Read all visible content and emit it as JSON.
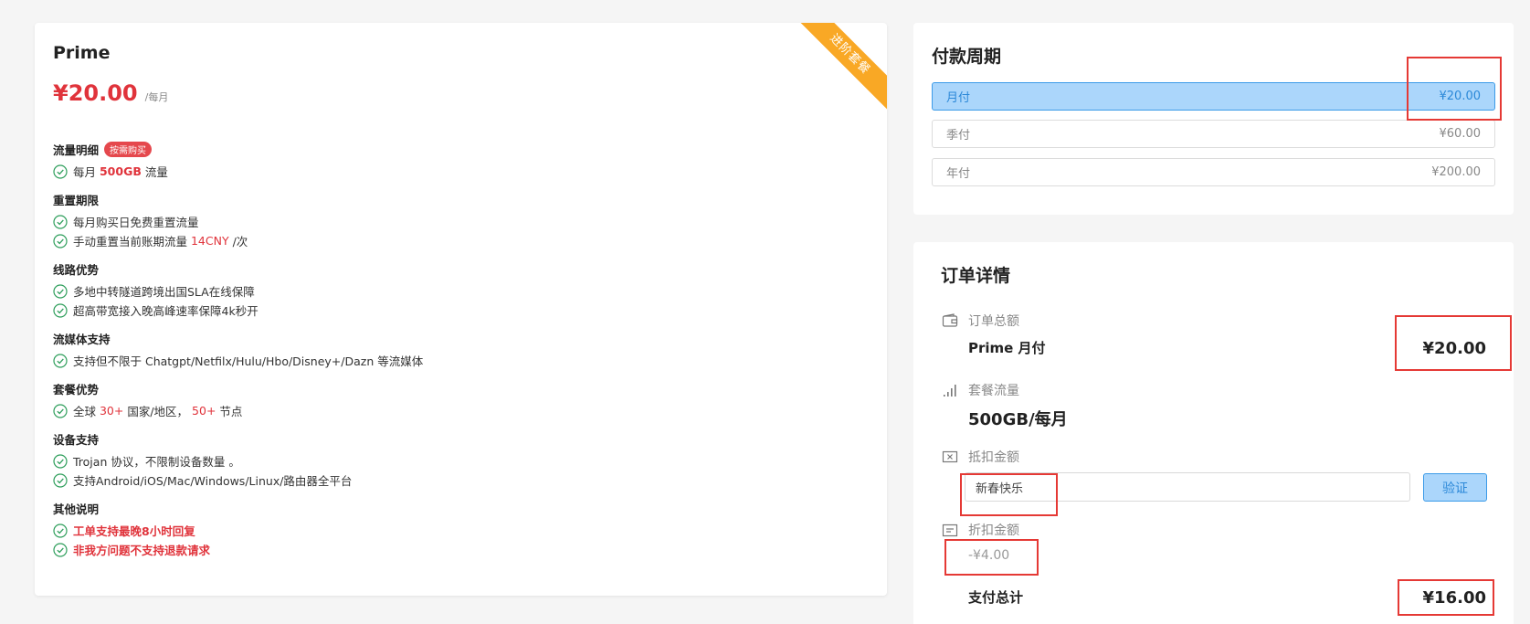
{
  "plan": {
    "ribbon": "进阶套餐",
    "name": "Prime",
    "price": "¥20.00",
    "price_unit": "/每月",
    "sections": [
      {
        "title": "流量明细",
        "badge": "按需购买",
        "items": [
          [
            {
              "t": "每月 "
            },
            {
              "t": "500GB",
              "s": "hl-b"
            },
            {
              "t": " 流量"
            }
          ]
        ]
      },
      {
        "title": "重置期限",
        "items": [
          [
            {
              "t": "每月购买日免费重置流量"
            }
          ],
          [
            {
              "t": "手动重置当前账期流量 "
            },
            {
              "t": "14CNY",
              "s": "hl"
            },
            {
              "t": " /次"
            }
          ]
        ]
      },
      {
        "title": "线路优势",
        "items": [
          [
            {
              "t": "多地中转隧道跨境出国SLA在线保障"
            }
          ],
          [
            {
              "t": "超高带宽接入晚高峰速率保障4k秒开"
            }
          ]
        ]
      },
      {
        "title": "流媒体支持",
        "items": [
          [
            {
              "t": "支持但不限于 Chatgpt/Netfilx/Hulu/Hbo/Disney+/Dazn 等流媒体"
            }
          ]
        ]
      },
      {
        "title": "套餐优势",
        "items": [
          [
            {
              "t": "全球 "
            },
            {
              "t": "30+",
              "s": "hl"
            },
            {
              "t": " 国家/地区， "
            },
            {
              "t": "50+",
              "s": "hl"
            },
            {
              "t": " 节点"
            }
          ]
        ]
      },
      {
        "title": "设备支持",
        "items": [
          [
            {
              "t": "Trojan 协议，不限制设备数量 。"
            }
          ],
          [
            {
              "t": "支持Android/iOS/Mac/Windows/Linux/路由器全平台"
            }
          ]
        ]
      },
      {
        "title": "其他说明",
        "items": [
          [
            {
              "t": "工单支持最晚8小时回复",
              "s": "red"
            }
          ],
          [
            {
              "t": "非我方问题不支持退款请求",
              "s": "red"
            }
          ]
        ]
      }
    ]
  },
  "payment_cycle": {
    "title": "付款周期",
    "options": [
      {
        "label": "月付",
        "price": "¥20.00",
        "selected": true
      },
      {
        "label": "季付",
        "price": "¥60.00",
        "selected": false
      },
      {
        "label": "年付",
        "price": "¥200.00",
        "selected": false
      }
    ]
  },
  "order": {
    "title": "订单详情",
    "total_label": "订单总额",
    "plan_cycle": "Prime 月付",
    "total_amount": "¥20.00",
    "traffic_label": "套餐流量",
    "traffic_value": "500GB/每月",
    "deduction_label": "抵扣金额",
    "coupon_value": "新春快乐",
    "verify_label": "验证",
    "discount_label": "折扣金额",
    "discount_value": "-¥4.00",
    "pay_total_label": "支付总计",
    "pay_total_amount": "¥16.00"
  },
  "colors": {
    "accent_red": "#e0333b",
    "ribbon": "#f9a825",
    "selected_bg": "#abd6fb",
    "selected_border": "#3c9be8",
    "check_green": "#2e9e5b",
    "highlight_box": "#e53935"
  },
  "icons": {
    "check": "check-circle-icon",
    "wallet": "wallet-icon",
    "signal": "signal-bars-icon",
    "coupon": "ticket-x-icon",
    "discount": "receipt-icon"
  }
}
